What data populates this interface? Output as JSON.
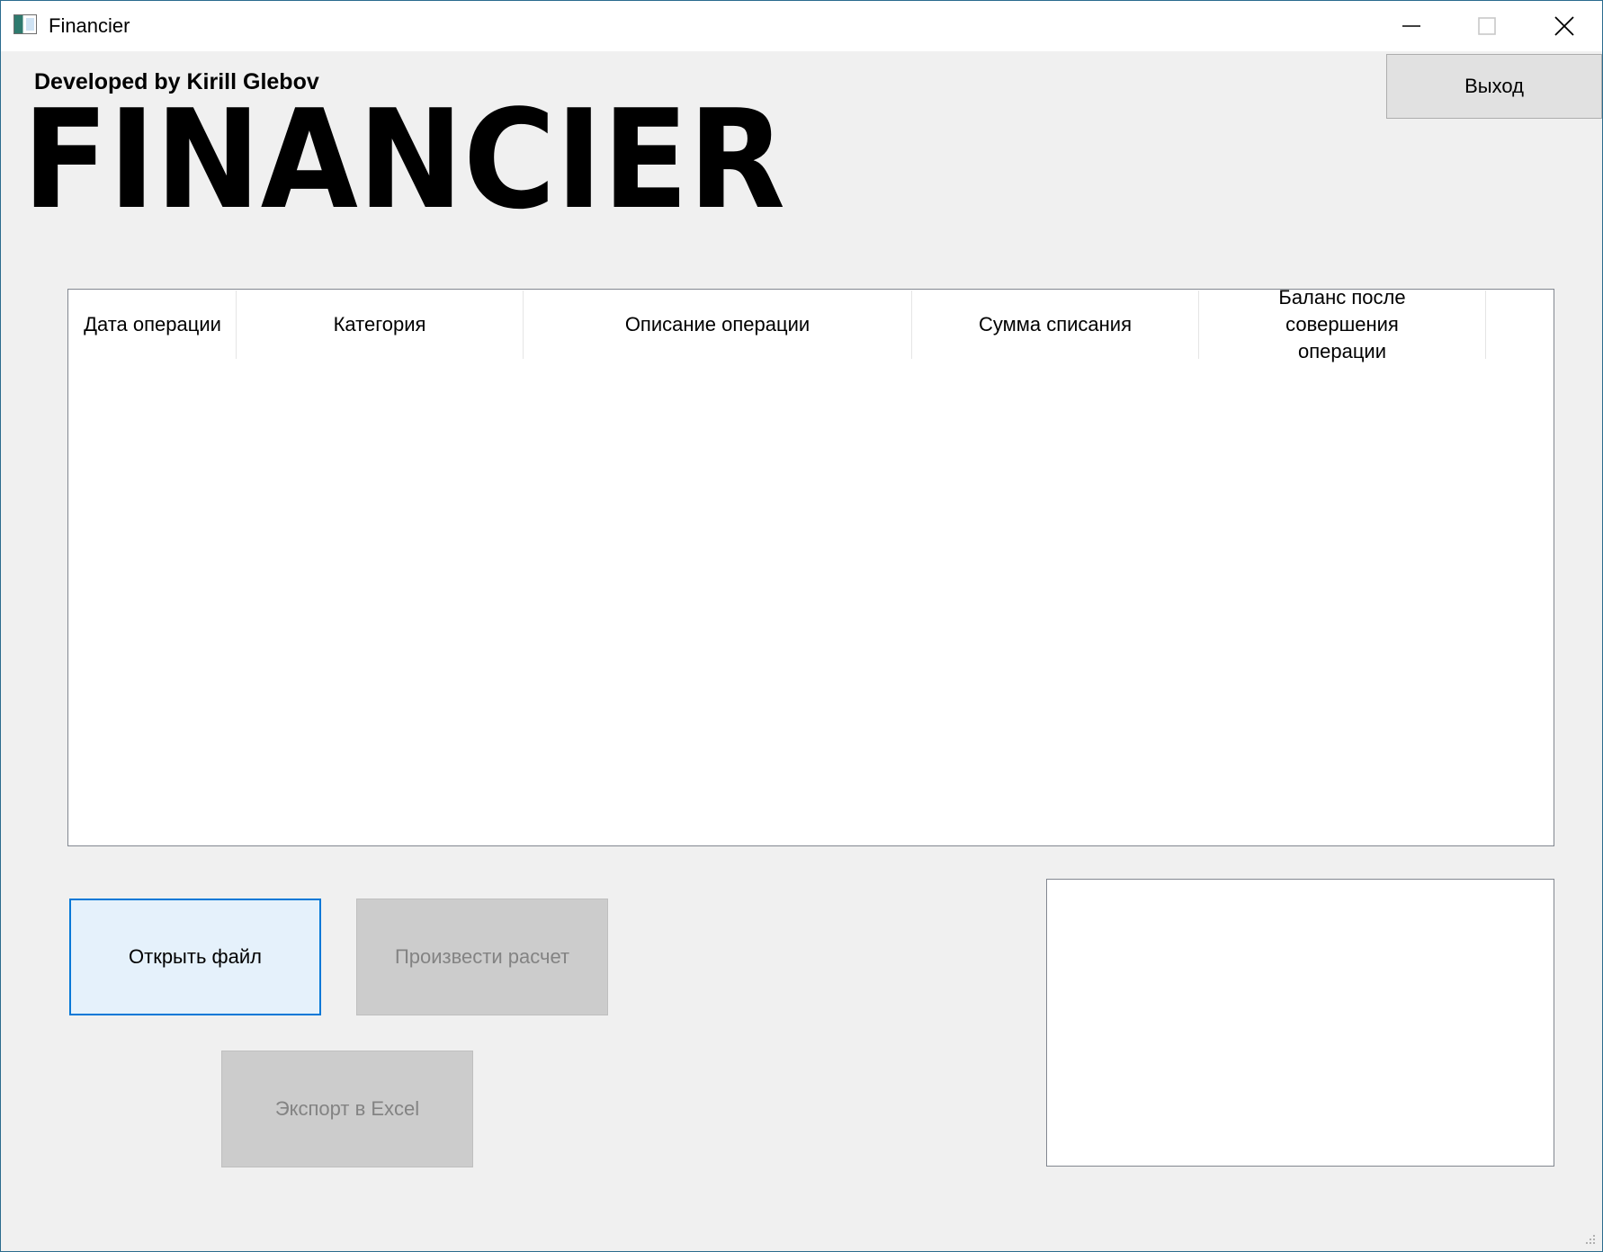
{
  "window": {
    "title": "Financier"
  },
  "header": {
    "credits": "Developed by Kirill Glebov",
    "logo_text": "FINANCIER",
    "exit_label": "Выход"
  },
  "table": {
    "columns": [
      {
        "label": "Дата операции"
      },
      {
        "label": "Категория"
      },
      {
        "label": "Описание операции"
      },
      {
        "label": "Сумма списания"
      },
      {
        "label": "Баланс после совершения операции"
      }
    ],
    "rows": []
  },
  "actions": {
    "open_label": "Открыть файл",
    "calc_label": "Произвести расчет",
    "export_label": "Экспорт в Excel"
  },
  "colors": {
    "accent": "#0078d7",
    "window_bg": "#f0f0f0",
    "disabled_button": "#cccccc",
    "disabled_text": "#838383"
  }
}
